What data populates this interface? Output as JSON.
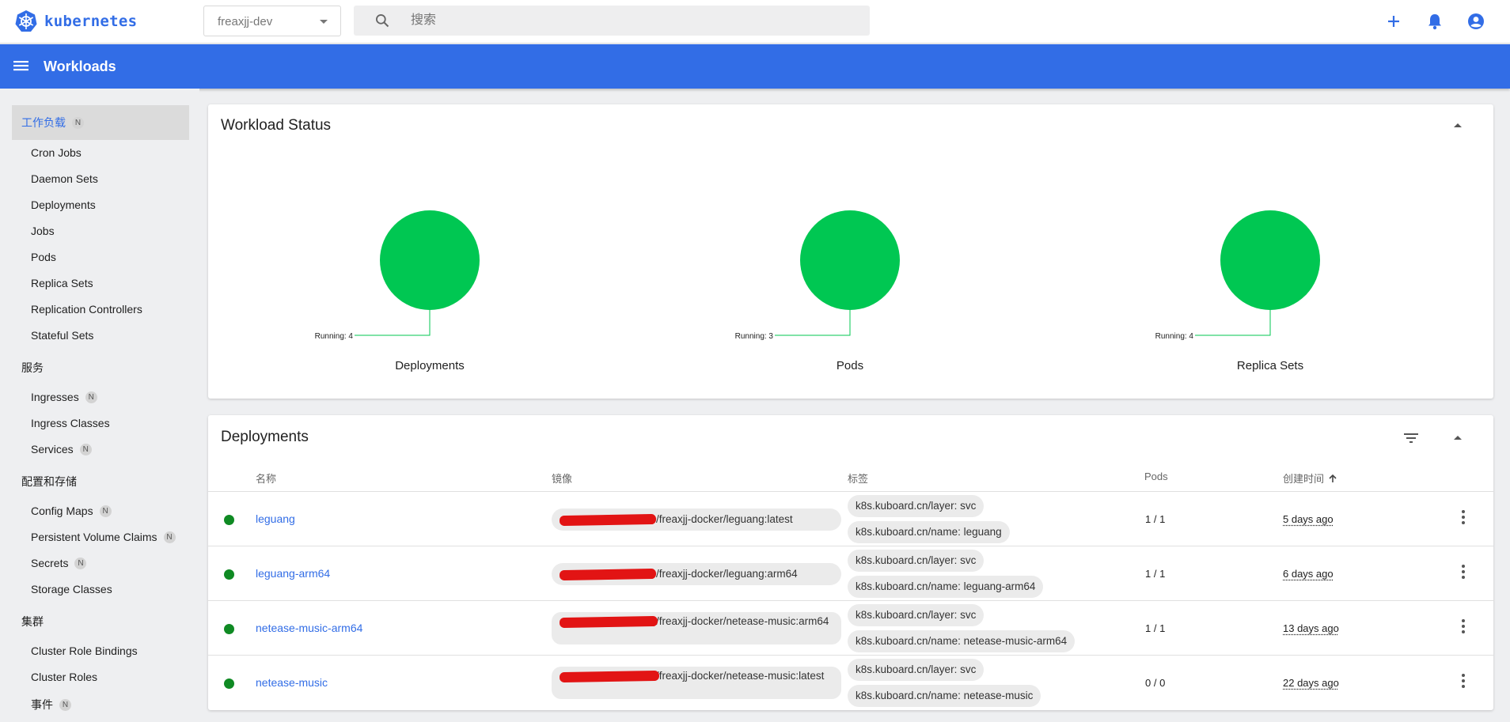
{
  "header": {
    "logo_text": "kubernetes",
    "namespace": "freaxjj-dev",
    "search_placeholder": "搜索",
    "actions": [
      "plus-icon",
      "bell-icon",
      "account-icon"
    ]
  },
  "appbar": {
    "title": "Workloads"
  },
  "sidebar": {
    "workloads_head": "工作负载",
    "workload_items": [
      "Cron Jobs",
      "Daemon Sets",
      "Deployments",
      "Jobs",
      "Pods",
      "Replica Sets",
      "Replication Controllers",
      "Stateful Sets"
    ],
    "service_group": "服务",
    "service_items": [
      "Ingresses",
      "Ingress Classes",
      "Services"
    ],
    "config_group": "配置和存储",
    "config_items": [
      "Config Maps",
      "Persistent Volume Claims",
      "Secrets",
      "Storage Classes"
    ],
    "cluster_group": "集群",
    "cluster_items": [
      "Cluster Role Bindings",
      "Cluster Roles",
      "事件"
    ],
    "badge": "N"
  },
  "workload_status": {
    "title": "Workload Status",
    "charts": [
      {
        "label": "Deployments",
        "running_text": "Running: 4",
        "running": 4
      },
      {
        "label": "Pods",
        "running_text": "Running: 3",
        "running": 3
      },
      {
        "label": "Replica Sets",
        "running_text": "Running: 4",
        "running": 4
      }
    ],
    "color": "#00c752"
  },
  "deployments": {
    "title": "Deployments",
    "columns": [
      "名称",
      "镜像",
      "标签",
      "Pods",
      "创建时间"
    ],
    "rows": [
      {
        "name": "leguang",
        "image": "/freaxjj-docker/leguang:latest",
        "labels": [
          "k8s.kuboard.cn/layer: svc",
          "k8s.kuboard.cn/name: leguang"
        ],
        "pods": "1 / 1",
        "created": "5 days ago"
      },
      {
        "name": "leguang-arm64",
        "image": "/freaxjj-docker/leguang:arm64",
        "labels": [
          "k8s.kuboard.cn/layer: svc",
          "k8s.kuboard.cn/name: leguang-arm64"
        ],
        "pods": "1 / 1",
        "created": "6 days ago"
      },
      {
        "name": "netease-music-arm64",
        "image": "/freaxjj-docker/netease-music:arm64",
        "labels": [
          "k8s.kuboard.cn/layer: svc",
          "k8s.kuboard.cn/name: netease-music-arm64"
        ],
        "pods": "1 / 1",
        "created": "13 days ago"
      },
      {
        "name": "netease-music",
        "image": "/freaxjj-docker/netease-music:latest",
        "labels": [
          "k8s.kuboard.cn/layer: svc",
          "k8s.kuboard.cn/name: netease-music"
        ],
        "pods": "0 / 0",
        "created": "22 days ago"
      }
    ],
    "status_color": "#0f8a23"
  }
}
